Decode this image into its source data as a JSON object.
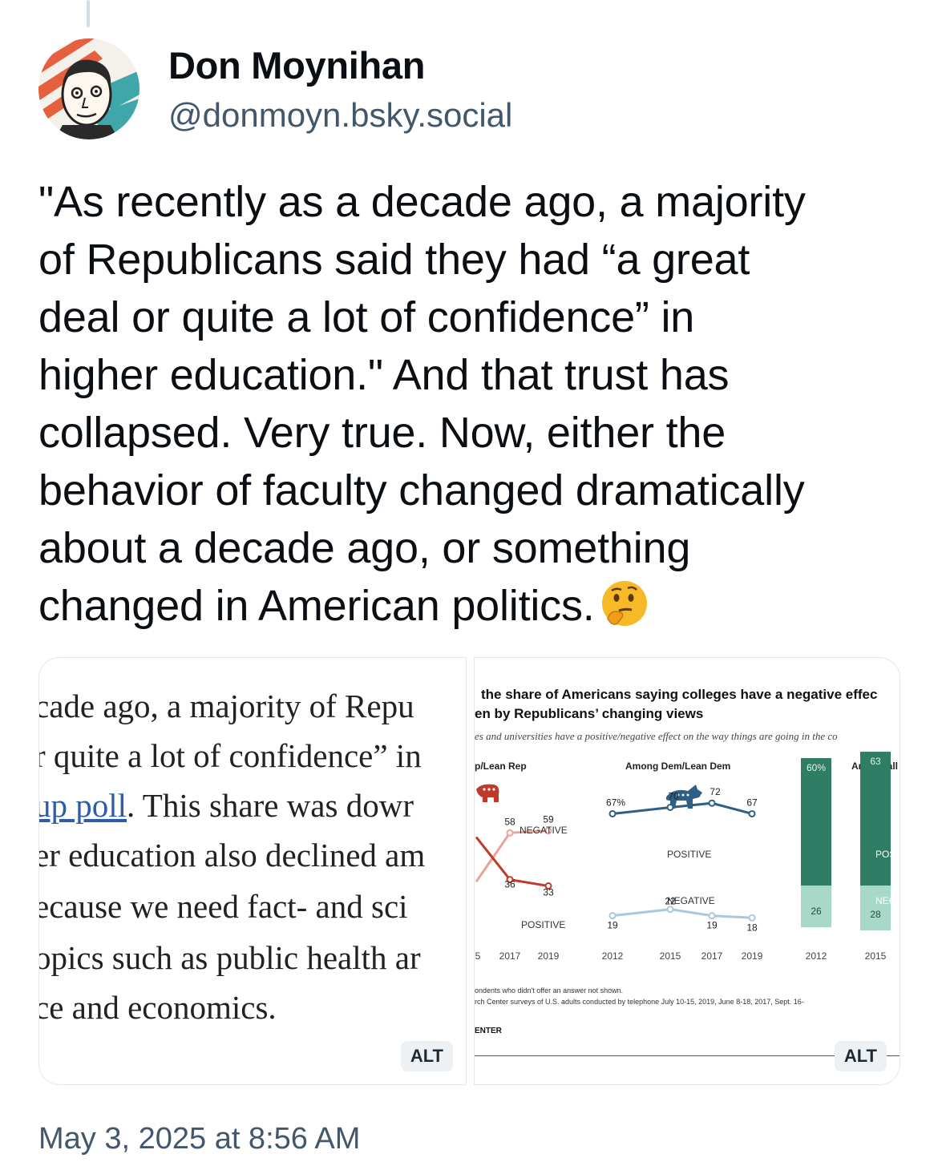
{
  "author": {
    "name": "Don Moynihan",
    "handle": "@donmoyn.bsky.social"
  },
  "post": {
    "lines": [
      "\"As recently as a decade ago, a majority",
      "of Republicans said they had “a great",
      "deal or quite a lot of confidence” in",
      "higher education.\" And that trust has",
      "collapsed. Very true. Now, either the",
      "behavior of faculty changed dramatically",
      "about a decade ago, or something",
      "changed in American politics."
    ],
    "emoji": "thinking-face-emoji"
  },
  "image_left": {
    "lines": [
      "cade ago, a majority of Repu",
      "r quite a lot of confidence” in",
      "up poll",
      ". This share was dowr",
      "er education also declined am",
      "ecause we need fact- and sci",
      "opics such as public health ar",
      "ce and economics."
    ],
    "alt_label": "ALT"
  },
  "image_right": {
    "title_line1": "the share of Americans saying colleges have a negative effec",
    "title_line2": "en by Republicans’ changing views",
    "subtitle": "es and universities have a positive/negative effect on the way things are going in the co",
    "panel_rep": "p/Lean Rep",
    "panel_dem": "Among Dem/Lean Dem",
    "panel_all": "Among all",
    "labels": {
      "negative": "NEGATIVE",
      "positive": "POSITIVE",
      "posit": "POSIT",
      "nega": "NEGA"
    },
    "footnote1": "ondents who didn't offer an answer not shown.",
    "footnote2": "rch Center surveys of U.S. adults conducted by telephone July 10-15, 2019, June 8-18, 2017, Sept. 16-",
    "pew_label": "ENTER",
    "alt_label": "ALT",
    "colors": {
      "rep_negative": "#e8a39a",
      "rep_positive": "#c0392b",
      "dem_positive": "#2f5f85",
      "dem_negative": "#a9c8dc",
      "all_positive": "#2e7d64",
      "all_negative": "#a8d8c6"
    }
  },
  "chart_data": {
    "type": "line",
    "panels": [
      {
        "name": "p/Lean Rep",
        "x": [
          "5",
          "2017",
          "2019"
        ],
        "series": [
          {
            "name": "NEGATIVE",
            "values": [
              null,
              58,
              59
            ]
          },
          {
            "name": "POSITIVE",
            "values": [
              null,
              36,
              33
            ]
          }
        ]
      },
      {
        "name": "Among Dem/Lean Dem",
        "x": [
          "2012",
          "2015",
          "2017",
          "2019"
        ],
        "series": [
          {
            "name": "POSITIVE",
            "values": [
              67,
              70,
              72,
              67
            ]
          },
          {
            "name": "NEGATIVE",
            "values": [
              19,
              22,
              19,
              18
            ]
          }
        ]
      },
      {
        "name": "Among all",
        "type": "bar",
        "x": [
          "2012",
          "2015"
        ],
        "series": [
          {
            "name": "POSIT",
            "values": [
              60,
              63
            ]
          },
          {
            "name": "NEGA",
            "values": [
              26,
              28
            ]
          }
        ]
      }
    ],
    "value_labels": {
      "rep": [
        "58",
        "59",
        "36",
        "33"
      ],
      "dem_pos": [
        "67%",
        "70",
        "72",
        "67"
      ],
      "dem_neg": [
        "19",
        "22",
        "19",
        "18"
      ],
      "all": [
        "60%",
        "63",
        "26",
        "28"
      ]
    },
    "ticks": {
      "rep": [
        "5",
        "2017",
        "2019"
      ],
      "dem": [
        "2012",
        "2015",
        "2017",
        "2019"
      ],
      "all": [
        "2012",
        "2015"
      ]
    }
  },
  "timestamp": "May 3, 2025 at 8:56 AM"
}
